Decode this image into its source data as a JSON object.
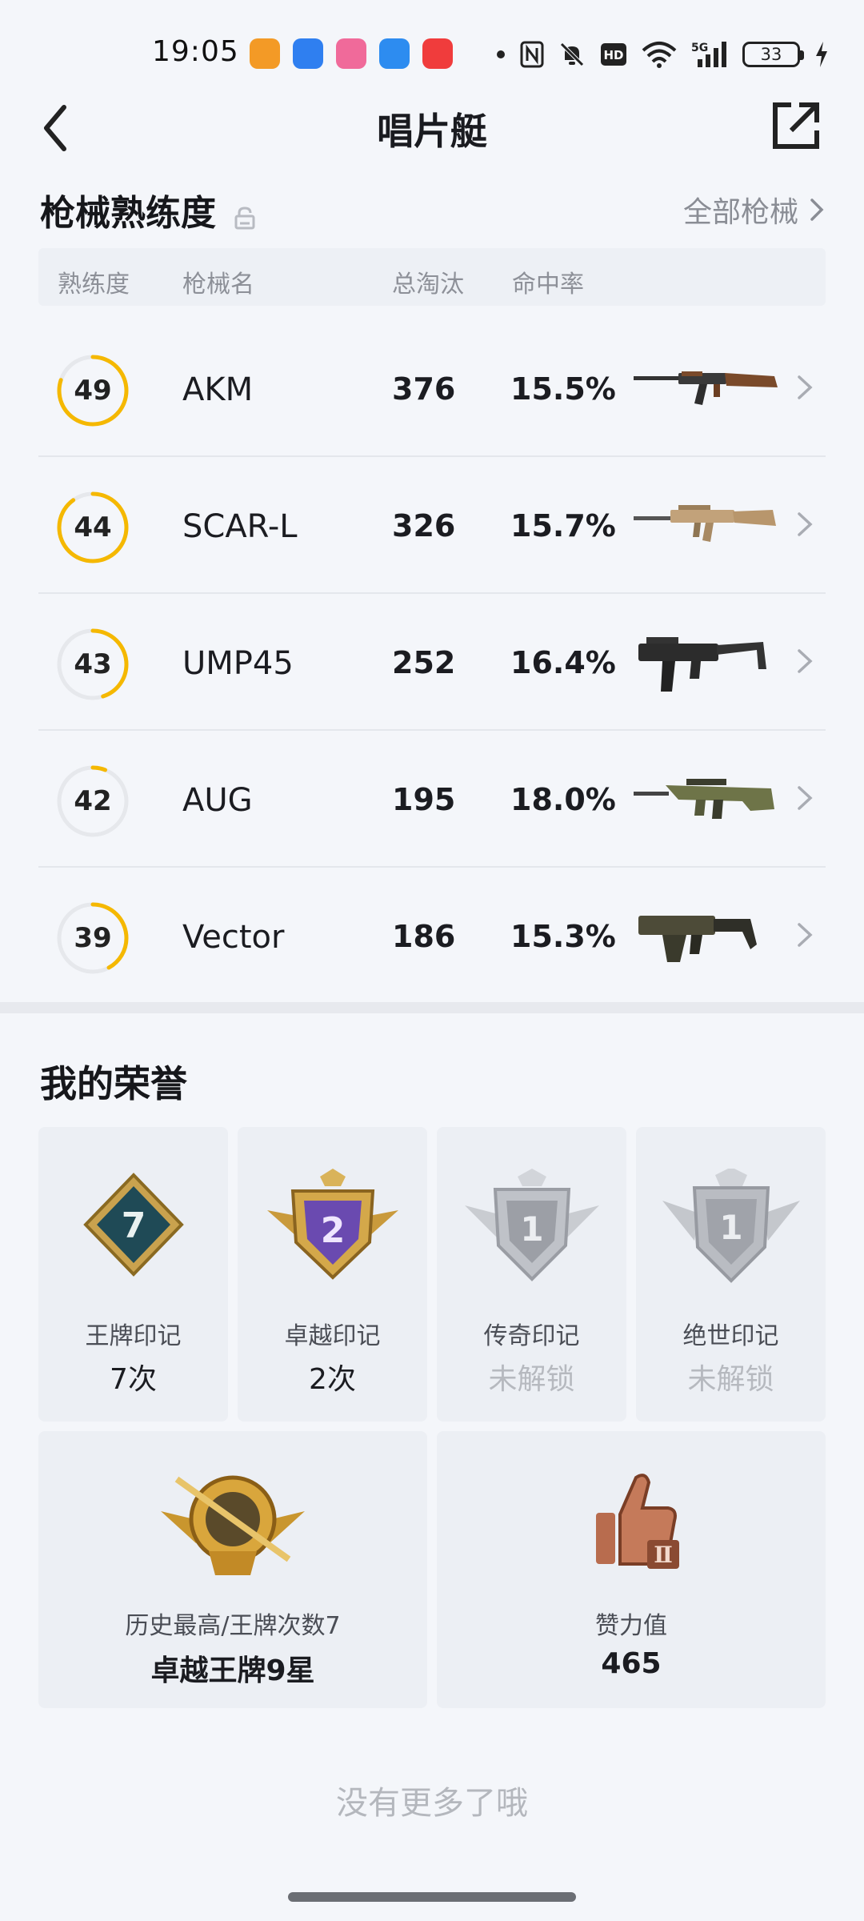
{
  "status_bar": {
    "time": "19:05",
    "network": "5G",
    "battery": "33",
    "app_icon_colors": [
      "#f39a26",
      "#2f7ff0",
      "#f06a9a",
      "#2d8cf0",
      "#f03c3c"
    ]
  },
  "nav": {
    "title": "唱片艇"
  },
  "weapons": {
    "section_title": "枪械熟练度",
    "all_link": "全部枪械",
    "columns": [
      "熟练度",
      "枪械名",
      "总淘汰",
      "命中率"
    ],
    "accent_color": "#f5b800",
    "rows": [
      {
        "level": "49",
        "name": "AKM",
        "kills": "376",
        "accuracy": "15.5%",
        "progress": 0.8,
        "image": "akm-rifle"
      },
      {
        "level": "44",
        "name": "SCAR-L",
        "kills": "326",
        "accuracy": "15.7%",
        "progress": 0.9,
        "image": "scar-l-rifle"
      },
      {
        "level": "43",
        "name": "UMP45",
        "kills": "252",
        "accuracy": "16.4%",
        "progress": 0.45,
        "image": "ump45-smg"
      },
      {
        "level": "42",
        "name": "AUG",
        "kills": "195",
        "accuracy": "18.0%",
        "progress": 0.06,
        "image": "aug-rifle"
      },
      {
        "level": "39",
        "name": "Vector",
        "kills": "186",
        "accuracy": "15.3%",
        "progress": 0.42,
        "image": "vector-smg"
      }
    ]
  },
  "honors": {
    "section_title": "我的荣誉",
    "marks": [
      {
        "label": "王牌印记",
        "value": "7次",
        "locked": false,
        "badge_text": "7",
        "badge": "ace-mark-badge"
      },
      {
        "label": "卓越印记",
        "value": "2次",
        "locked": false,
        "badge_text": "2",
        "badge": "excellence-mark-badge"
      },
      {
        "label": "传奇印记",
        "value": "未解锁",
        "locked": true,
        "badge_text": "1",
        "badge": "legend-mark-badge"
      },
      {
        "label": "绝世印记",
        "value": "未解锁",
        "locked": true,
        "badge_text": "1",
        "badge": "peerless-mark-badge"
      }
    ],
    "highest": {
      "label": "历史最高/王牌次数7",
      "value": "卓越王牌9星",
      "badge": "rank-sniper-badge"
    },
    "likes": {
      "label": "赞力值",
      "value": "465",
      "badge": "thumbs-up-badge"
    }
  },
  "footer": {
    "no_more": "没有更多了哦"
  }
}
